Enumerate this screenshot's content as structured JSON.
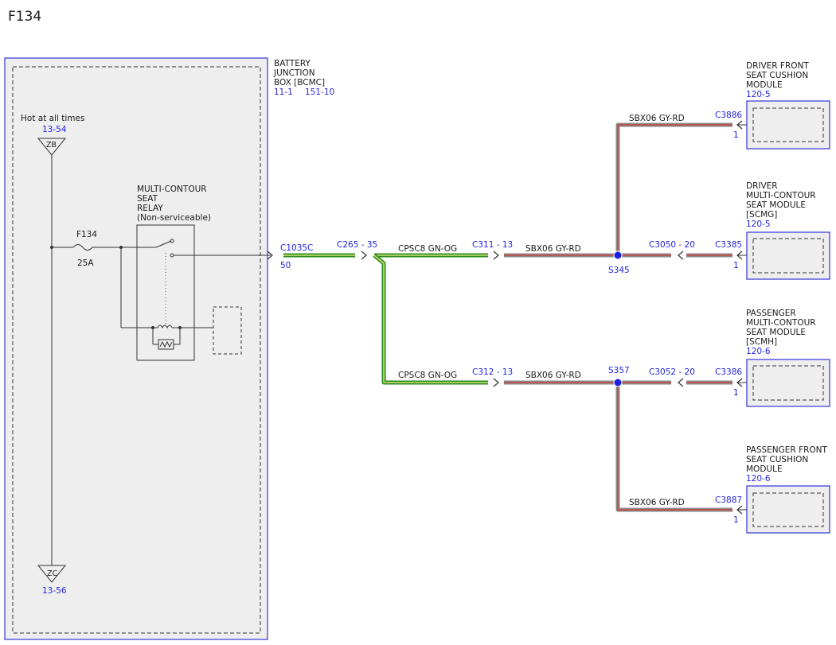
{
  "page_title": "F134",
  "bjb": {
    "name_lines": [
      "BATTERY",
      "JUNCTION",
      "BOX [BCMC]"
    ],
    "ref_left": "11-1",
    "ref_right": "151-10"
  },
  "power": {
    "label": "Hot at all times",
    "top_ref": "13-54",
    "top_code": "ZB",
    "bottom_code": "ZC",
    "bottom_ref": "13-56"
  },
  "fuse": {
    "name": "F134",
    "rating": "25A"
  },
  "relay": {
    "name_lines": [
      "MULTI-CONTOUR",
      "SEAT",
      "RELAY",
      "(Non-serviceable)"
    ]
  },
  "connectors": {
    "c1035c": "C1035C",
    "c1035c_pin": "50",
    "c265": "C265 - 35",
    "c311": "C311 - 13",
    "c312": "C312 - 13",
    "c3050": "C3050 - 20",
    "c3052": "C3052 - 20",
    "c3886": "C3886",
    "c3886_pin": "1",
    "c3385": "C3385",
    "c3385_pin": "1",
    "c3386": "C3386",
    "c3386_pin": "1",
    "c3887": "C3887",
    "c3887_pin": "1"
  },
  "splices": {
    "s345": "S345",
    "s357": "S357"
  },
  "wires": {
    "cpsc8_a": "CPSC8  GN-OG",
    "cpsc8_b": "CPSC8  GN-OG",
    "sbx06_a": "SBX06  GY-RD",
    "sbx06_b": "SBX06  GY-RD",
    "sbx06_top": "SBX06  GY-RD",
    "sbx06_bottom": "SBX06  GY-RD"
  },
  "modules": {
    "driver_cushion": {
      "lines": [
        "DRIVER FRONT",
        "SEAT CUSHION",
        "MODULE"
      ],
      "ref": "120-5"
    },
    "driver_mc": {
      "lines": [
        "DRIVER",
        "MULTI-CONTOUR",
        "SEAT MODULE",
        "[SCMG]"
      ],
      "ref": "120-5"
    },
    "passenger_mc": {
      "lines": [
        "PASSENGER",
        "MULTI-CONTOUR",
        "SEAT MODULE",
        "[SCMH]"
      ],
      "ref": "120-6"
    },
    "passenger_cushion": {
      "lines": [
        "PASSENGER FRONT",
        "SEAT CUSHION",
        "MODULE"
      ],
      "ref": "120-6"
    }
  },
  "colors": {
    "border_blue": "#3333dd",
    "module_fill": "#eeeeee",
    "green_wire": "#2e8b1e",
    "green_wire_core": "#b5d96a",
    "gray_wire": "#8a8a8a",
    "red_wire": "#c0504d",
    "splice_blue": "#1f1fe0"
  }
}
